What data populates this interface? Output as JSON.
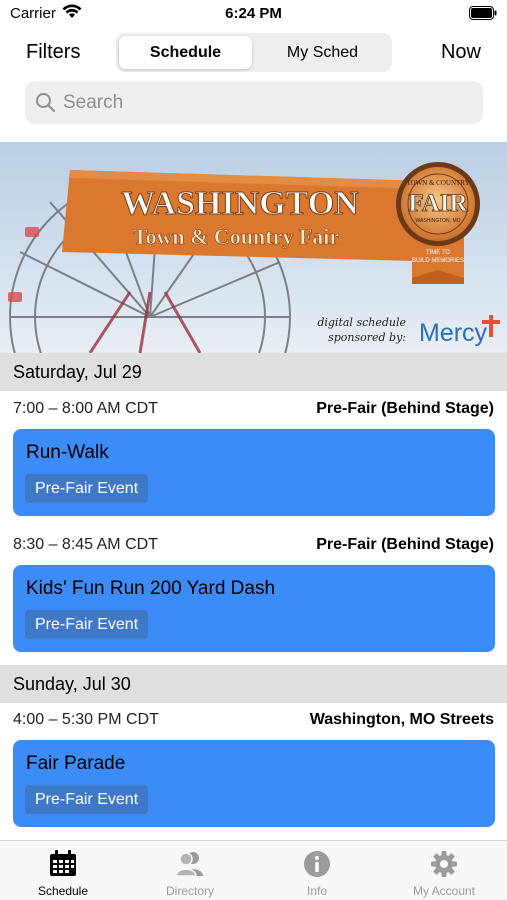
{
  "status_bar": {
    "carrier": "Carrier",
    "time": "6:24 PM"
  },
  "nav": {
    "filters_label": "Filters",
    "now_label": "Now",
    "segments": [
      "Schedule",
      "My Sched"
    ],
    "selected_segment": "Schedule"
  },
  "search": {
    "placeholder": "Search",
    "value": ""
  },
  "banner": {
    "title_line1": "WASHINGTON",
    "title_line2": "Town & Country Fair",
    "badge_top": "TOWN & COUNTRY",
    "badge_main": "FAIR",
    "badge_sub": "WASHINGTON, MO",
    "badge_ribbon1": "TIME TO",
    "badge_ribbon2": "BUILD MEMORIES",
    "sponsor_line1": "digital schedule",
    "sponsor_line2": "sponsored by:",
    "sponsor_name": "Mercy"
  },
  "schedule": [
    {
      "day": "Saturday, Jul 29",
      "events": [
        {
          "time": "7:00 – 8:00 AM CDT",
          "location": "Pre-Fair (Behind Stage)",
          "title": "Run-Walk",
          "tag": "Pre-Fair Event"
        },
        {
          "time": "8:30 – 8:45 AM CDT",
          "location": "Pre-Fair (Behind Stage)",
          "title": "Kids' Fun Run 200 Yard Dash",
          "tag": "Pre-Fair Event"
        }
      ]
    },
    {
      "day": "Sunday, Jul 30",
      "events": [
        {
          "time": "4:00 – 5:30 PM CDT",
          "location": "Washington, MO Streets",
          "title": "Fair Parade",
          "tag": "Pre-Fair Event"
        }
      ]
    }
  ],
  "tabs": [
    {
      "label": "Schedule",
      "icon": "calendar-icon",
      "active": true
    },
    {
      "label": "Directory",
      "icon": "people-icon",
      "active": false
    },
    {
      "label": "Info",
      "icon": "info-icon",
      "active": false
    },
    {
      "label": "My Account",
      "icon": "gear-icon",
      "active": false
    }
  ],
  "colors": {
    "event_card": "#3b8cf6",
    "event_tag": "#3f79c6",
    "day_header": "#dddfe0",
    "banner_orange": "#d9782e",
    "tab_inactive": "#9b9b9b"
  }
}
